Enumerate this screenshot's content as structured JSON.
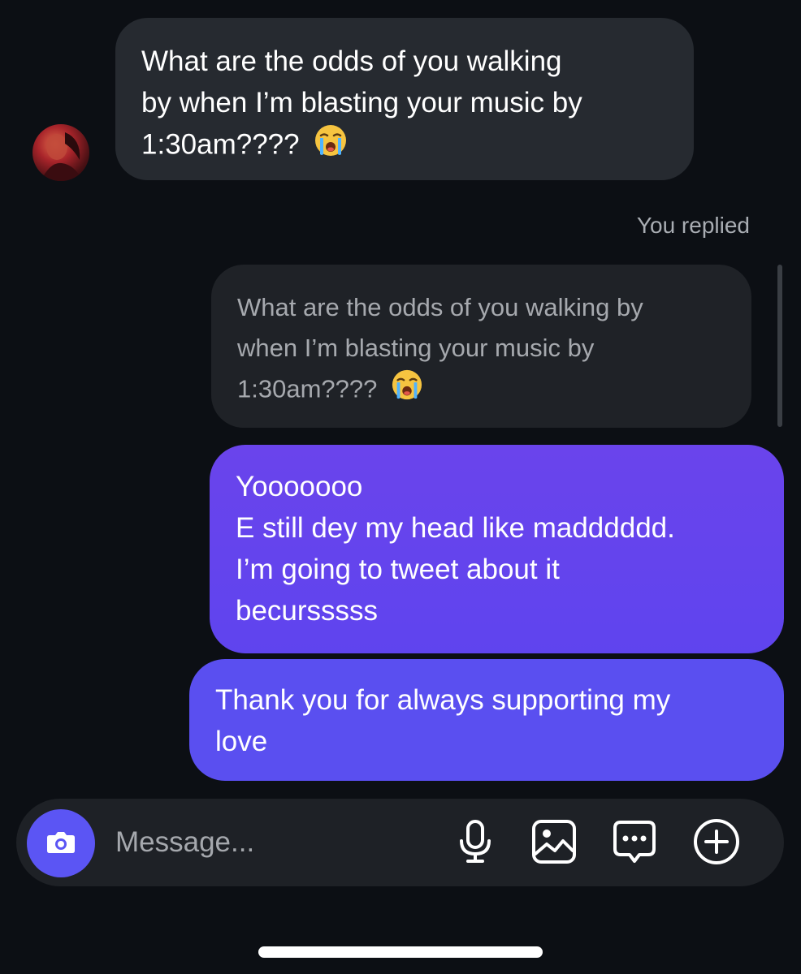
{
  "conversation": {
    "incoming": {
      "lines": [
        "What are the odds of you walking",
        "by when I’m blasting your music by",
        "1:30am????"
      ],
      "emoji": "loudly-crying-face"
    },
    "replied_label": "You replied",
    "quoted": {
      "lines": [
        "What are the odds of you walking by",
        "when I’m blasting your music by",
        "1:30am????"
      ],
      "emoji": "loudly-crying-face"
    },
    "outgoing_1": {
      "lines": [
        "Yooooooo",
        "E still dey my head like madddddd.",
        "I’m going to tweet about it",
        "becursssss"
      ]
    },
    "outgoing_2": {
      "lines": [
        "Thank you for always supporting my",
        "love"
      ]
    }
  },
  "composer": {
    "placeholder": "Message...",
    "icons": [
      "camera-icon",
      "microphone-icon",
      "gallery-icon",
      "sticker-icon",
      "plus-icon"
    ]
  },
  "colors": {
    "background": "#0c0f14",
    "incoming_bubble": "#262a30",
    "quoted_bubble": "#1f2227",
    "outgoing_bubble": "#5f44ee",
    "accent": "#5b55f4"
  }
}
